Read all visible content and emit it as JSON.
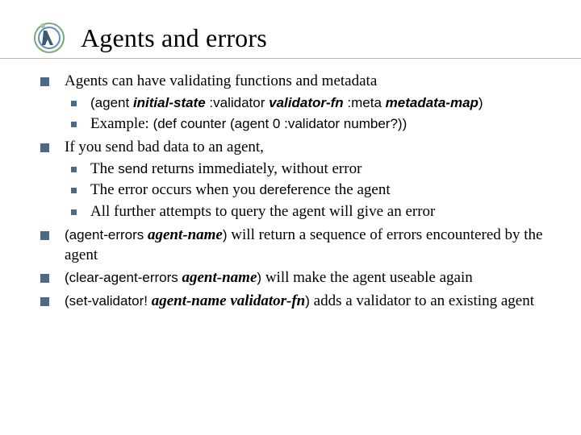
{
  "title": "Agents and errors",
  "b1": "Agents can have validating functions and metadata",
  "b1a_p1": "(agent ",
  "b1a_p2": "initial-state",
  "b1a_p3": " :validator ",
  "b1a_p4": "validator-fn",
  "b1a_p5": " :meta ",
  "b1a_p6": "metadata-map",
  "b1a_p7": ")",
  "b1b_p1": "Example: ",
  "b1b_p2": "(def counter (agent 0 :validator number?))",
  "b2": "If you send bad data to an agent,",
  "b2a_p1": "The ",
  "b2a_p2": "send",
  "b2a_p3": " returns immediately, without error",
  "b2b_p1": "The error occurs when you ",
  "b2b_p2": "deref",
  "b2b_p3": "erence the agent",
  "b2c": "All further attempts to query the agent will give an error",
  "b3_p1": "(agent-errors  ",
  "b3_p2": "agent-name",
  "b3_p3": ")",
  "b3_p4": " will return a sequence of errors encountered by the agent",
  "b4_p1": "(clear-agent-errors  ",
  "b4_p2": "agent-name",
  "b4_p3": ")",
  "b4_p4": " will make the agent useable again",
  "b5_p1": "(set-validator! ",
  "b5_p2": "agent-name",
  "b5_p3": "  ",
  "b5_p4": "validator-fn",
  "b5_p5": ")",
  "b5_p6": " adds a validator to an existing agent"
}
